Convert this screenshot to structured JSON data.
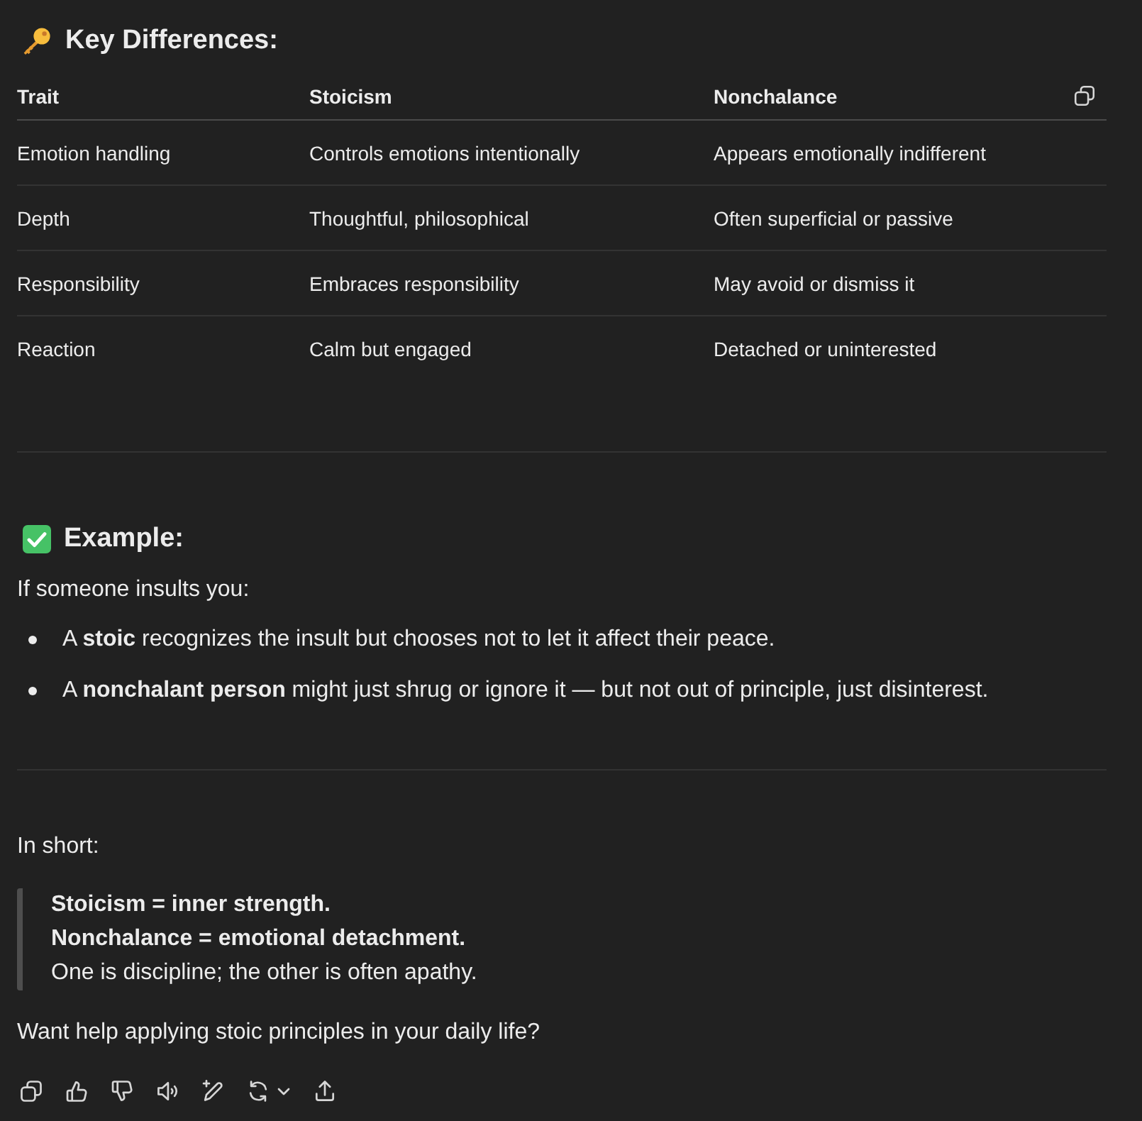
{
  "key_differences": {
    "heading": "Key Differences:",
    "table": {
      "columns": [
        "Trait",
        "Stoicism",
        "Nonchalance"
      ],
      "rows": [
        [
          "Emotion handling",
          "Controls emotions intentionally",
          "Appears emotionally indifferent"
        ],
        [
          "Depth",
          "Thoughtful, philosophical",
          "Often superficial or passive"
        ],
        [
          "Responsibility",
          "Embraces responsibility",
          "May avoid or dismiss it"
        ],
        [
          "Reaction",
          "Calm but engaged",
          "Detached or uninterested"
        ]
      ]
    }
  },
  "example": {
    "heading": "Example:",
    "intro": "If someone insults you:",
    "bullets": [
      "A **stoic** recognizes the insult but chooses not to let it affect their peace.",
      "A **nonchalant person** might just shrug or ignore it — but not out of principle, just disinterest."
    ]
  },
  "summary": {
    "intro": "In short:",
    "quote_lines": [
      {
        "text": "Stoicism = inner strength.",
        "bold": true
      },
      {
        "text": "Nonchalance = emotional detachment.",
        "bold": true
      },
      {
        "text": "One is discipline; the other is often apathy.",
        "bold": false
      }
    ],
    "question": "Want help applying stoic principles in your daily life?"
  }
}
